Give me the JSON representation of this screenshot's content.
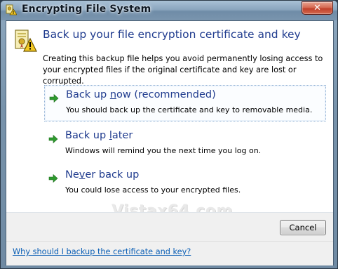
{
  "window": {
    "title": "Encrypting File System",
    "close_label": "✕"
  },
  "header": {
    "heading": "Back up your file encryption certificate and key",
    "description": "Creating this backup file helps you avoid permanently losing access to your encrypted files if the original certificate and key are lost or corrupted."
  },
  "options": [
    {
      "title_pre": "Back up ",
      "title_ul": "n",
      "title_post": "ow (recommended)",
      "subtitle": "You should back up the certificate and key to removable media."
    },
    {
      "title_pre": "Back up ",
      "title_ul": "l",
      "title_post": "ater",
      "subtitle": "Windows will remind you the next time you log on."
    },
    {
      "title_pre": "Ne",
      "title_ul": "v",
      "title_post": "er back up",
      "subtitle": "You could lose access to your encrypted files."
    }
  ],
  "watermark": "Vistax64.com",
  "buttons": {
    "cancel": "Cancel"
  },
  "footer": {
    "help_link": "Why should I backup the certificate and key?"
  },
  "icons": {
    "title": "efs-certificate-warning-icon",
    "header": "efs-certificate-warning-icon",
    "option_arrow": "green-arrow-icon"
  },
  "colors": {
    "heading": "#1f3b8e",
    "link": "#0b5fb5",
    "arrow": "#2f9b2f",
    "close": "#c1402a"
  }
}
